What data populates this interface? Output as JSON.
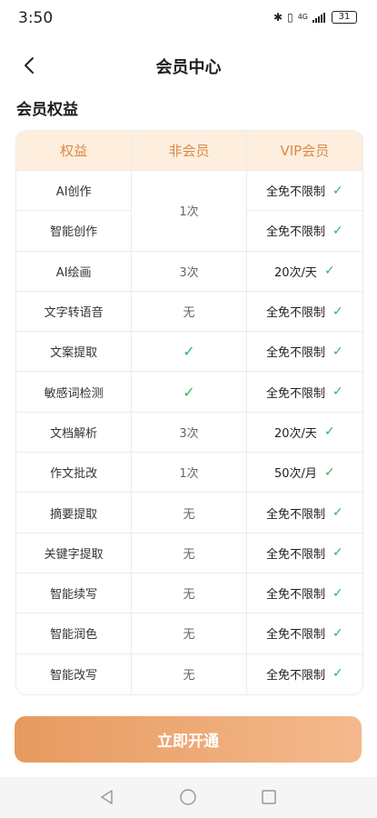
{
  "status_bar": {
    "time": "3:50",
    "network": "4G",
    "battery": "31"
  },
  "header": {
    "title": "会员中心"
  },
  "section": {
    "title": "会员权益"
  },
  "table": {
    "headers": [
      "权益",
      "非会员",
      "VIP会员"
    ],
    "merged": {
      "non_member": "1次",
      "rows": [
        {
          "name": "AI创作",
          "vip": "全免不限制"
        },
        {
          "name": "智能创作",
          "vip": "全免不限制"
        }
      ]
    },
    "rows": [
      {
        "name": "AI绘画",
        "non_member": "3次",
        "vip": "20次/天"
      },
      {
        "name": "文字转语音",
        "non_member": "无",
        "vip": "全免不限制"
      },
      {
        "name": "文案提取",
        "non_member": "✓",
        "vip": "全免不限制"
      },
      {
        "name": "敏感词检测",
        "non_member": "✓",
        "vip": "全免不限制"
      },
      {
        "name": "文档解析",
        "non_member": "3次",
        "vip": "20次/天"
      },
      {
        "name": "作文批改",
        "non_member": "1次",
        "vip": "50次/月"
      },
      {
        "name": "摘要提取",
        "non_member": "无",
        "vip": "全免不限制"
      },
      {
        "name": "关键字提取",
        "non_member": "无",
        "vip": "全免不限制"
      },
      {
        "name": "智能续写",
        "non_member": "无",
        "vip": "全免不限制"
      },
      {
        "name": "智能润色",
        "non_member": "无",
        "vip": "全免不限制"
      },
      {
        "name": "智能改写",
        "non_member": "无",
        "vip": "全免不限制"
      }
    ],
    "check_glyph": "✓",
    "colors": {
      "check": "#2bb75c",
      "header_bg": "#fdeedd",
      "header_text": "#d98a4a"
    }
  },
  "cta": {
    "label": "立即开通",
    "gradient_start": "#e79a5f",
    "gradient_end": "#f4b98d"
  }
}
